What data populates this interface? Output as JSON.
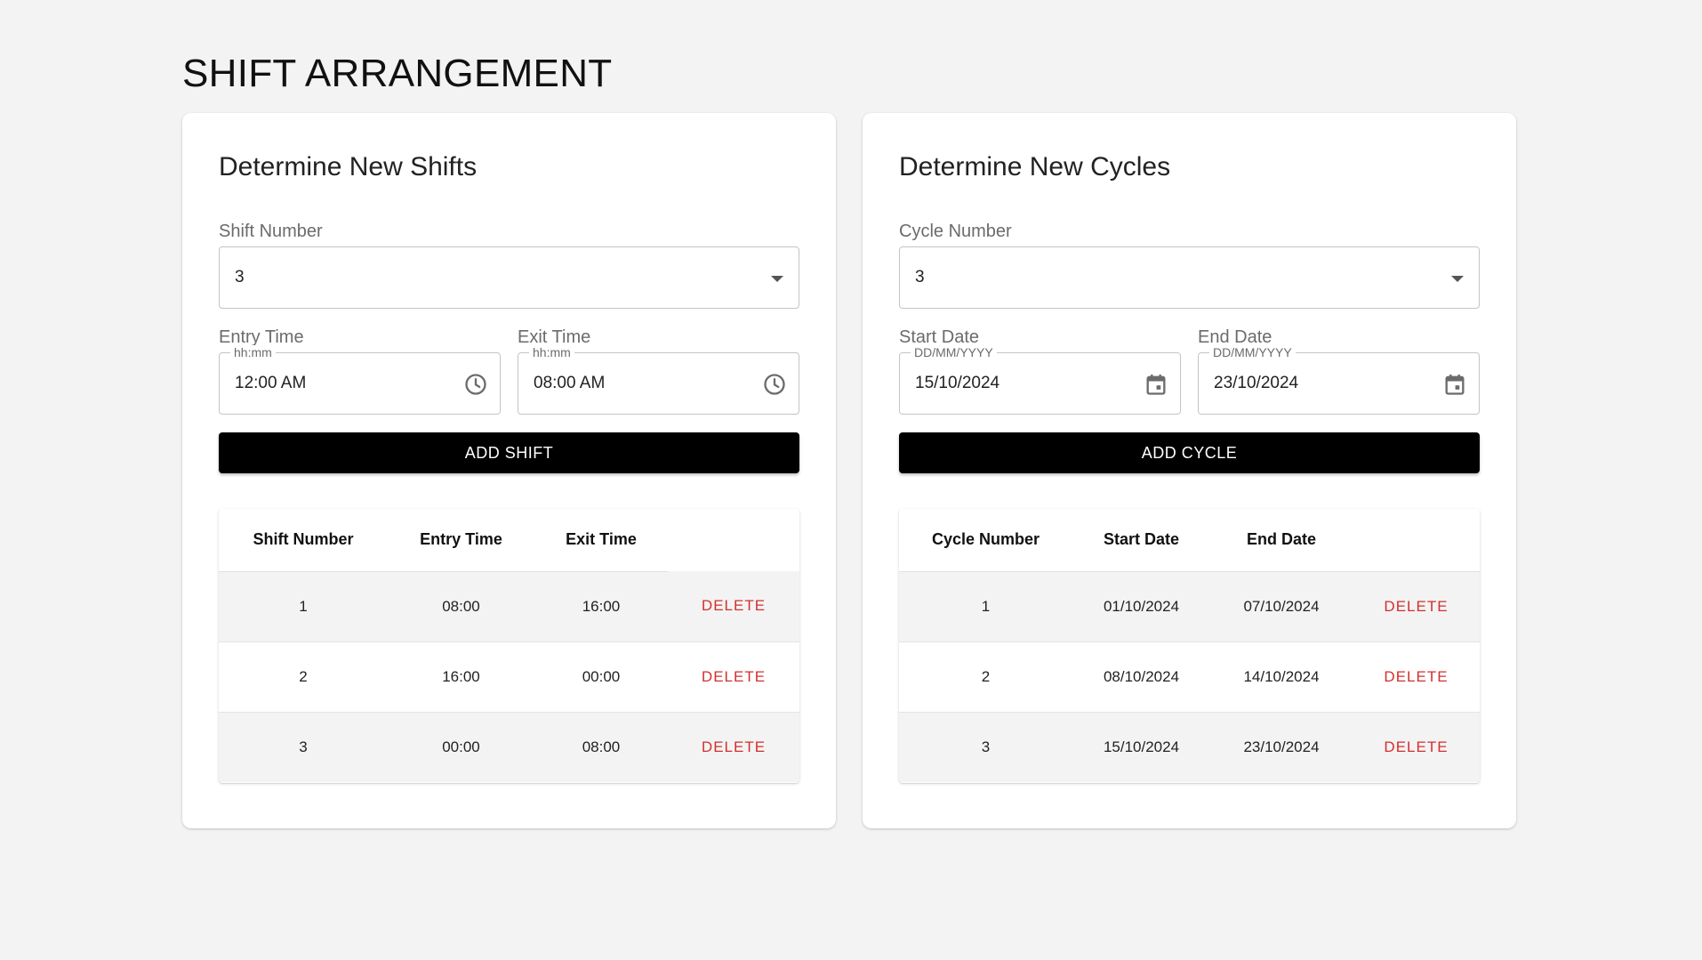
{
  "page": {
    "title": "SHIFT ARRANGEMENT"
  },
  "shifts_card": {
    "title": "Determine New Shifts",
    "shift_number": {
      "label": "Shift Number",
      "value": "3"
    },
    "entry_time": {
      "label": "Entry Time",
      "format": "hh:mm",
      "value": "12:00 AM"
    },
    "exit_time": {
      "label": "Exit Time",
      "format": "hh:mm",
      "value": "08:00 AM"
    },
    "add_button": "ADD SHIFT",
    "table": {
      "headers": [
        "Shift Number",
        "Entry Time",
        "Exit Time"
      ],
      "rows": [
        {
          "number": "1",
          "entry": "08:00",
          "exit": "16:00",
          "action": "DELETE"
        },
        {
          "number": "2",
          "entry": "16:00",
          "exit": "00:00",
          "action": "DELETE"
        },
        {
          "number": "3",
          "entry": "00:00",
          "exit": "08:00",
          "action": "DELETE"
        }
      ]
    }
  },
  "cycles_card": {
    "title": "Determine New Cycles",
    "cycle_number": {
      "label": "Cycle Number",
      "value": "3"
    },
    "start_date": {
      "label": "Start Date",
      "format": "DD/MM/YYYY",
      "value": "15/10/2024"
    },
    "end_date": {
      "label": "End Date",
      "format": "DD/MM/YYYY",
      "value": "23/10/2024"
    },
    "add_button": "ADD CYCLE",
    "table": {
      "headers": [
        "Cycle Number",
        "Start Date",
        "End Date"
      ],
      "rows": [
        {
          "number": "1",
          "start": "01/10/2024",
          "end": "07/10/2024",
          "action": "DELETE"
        },
        {
          "number": "2",
          "start": "08/10/2024",
          "end": "14/10/2024",
          "action": "DELETE"
        },
        {
          "number": "3",
          "start": "15/10/2024",
          "end": "23/10/2024",
          "action": "DELETE"
        }
      ]
    }
  },
  "icons": {
    "time_picker": "clock-icon",
    "date_picker": "calendar-icon",
    "select": "caret-down-icon"
  },
  "colors": {
    "background": "#f3f3f3",
    "button": "#000000",
    "delete": "#d32f2f",
    "row_shade": "#f3f3f3"
  }
}
